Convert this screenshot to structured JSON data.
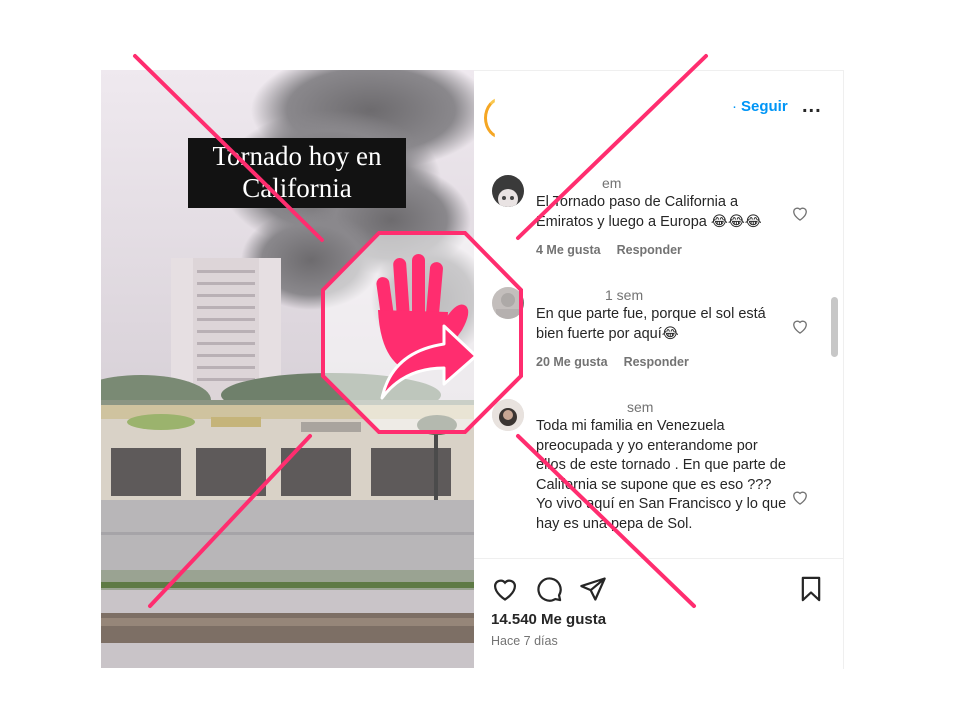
{
  "media": {
    "caption_line1": "Tornado hoy en",
    "caption_line2": "California"
  },
  "header": {
    "follow_dot": "·",
    "follow_label": "Seguir",
    "more_label": "..."
  },
  "comments": [
    {
      "time": "em",
      "text": "El Tornado paso de California a Emiratos y luego a Europa 😂😂😂",
      "likes": "4 Me gusta",
      "reply": "Responder"
    },
    {
      "time": "1 sem",
      "text": "En que parte fue, porque el sol está bien fuerte por aquí😂",
      "likes": "20 Me gusta",
      "reply": "Responder"
    },
    {
      "time": "sem",
      "text": "Toda mi familia en Venezuela preocupada y yo enterandome por ellos de este tornado . En que parte de California se supone que es eso ??? Yo vivo aquí en San Francisco y lo que hay es una pepa de Sol."
    }
  ],
  "footer": {
    "likes": "14.540 Me gusta",
    "date": "Hace 7 días"
  },
  "icons": {
    "like": "heart-icon",
    "comment": "comment-icon",
    "share": "send-icon",
    "save": "bookmark-icon",
    "overlay": "stop-hand-icon"
  },
  "colors": {
    "accent_link": "#0095f6",
    "overlay": "#ff2d6f"
  }
}
